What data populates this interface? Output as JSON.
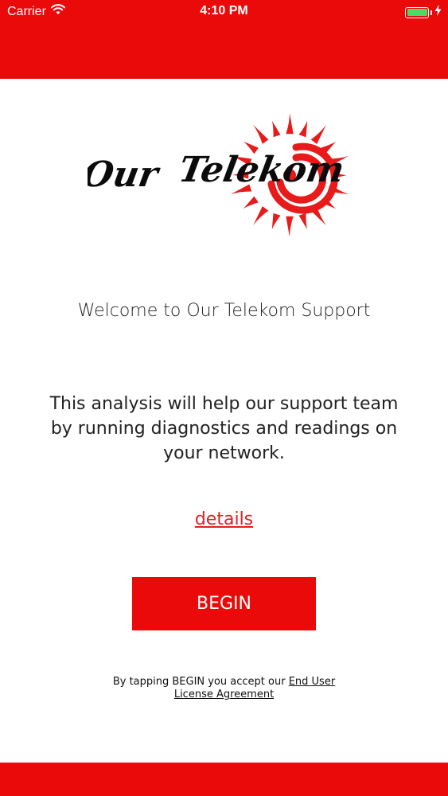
{
  "status_bar": {
    "carrier": "Carrier",
    "time": "4:10 PM",
    "wifi_icon": "wifi-icon",
    "battery_icon": "battery-icon",
    "charging_icon": "charging-bolt-icon",
    "battery_level": 1.0
  },
  "logo": {
    "text": "Our Telekom",
    "icon": "sun-logo-icon"
  },
  "welcome": "Welcome to Our Telekom Support",
  "analysis": {
    "line1": "This analysis will help our support team",
    "line2": "by running diagnostics and readings on",
    "line3": "your network."
  },
  "details_link": "details",
  "begin_button": "BEGIN",
  "legal": {
    "prefix": "By tapping BEGIN you accept our ",
    "link_part1": "End User",
    "link_part2": "License Agreement"
  },
  "colors": {
    "brand_red": "#ea0a0a",
    "link_red": "#e02020",
    "battery_green": "#4cd964"
  }
}
